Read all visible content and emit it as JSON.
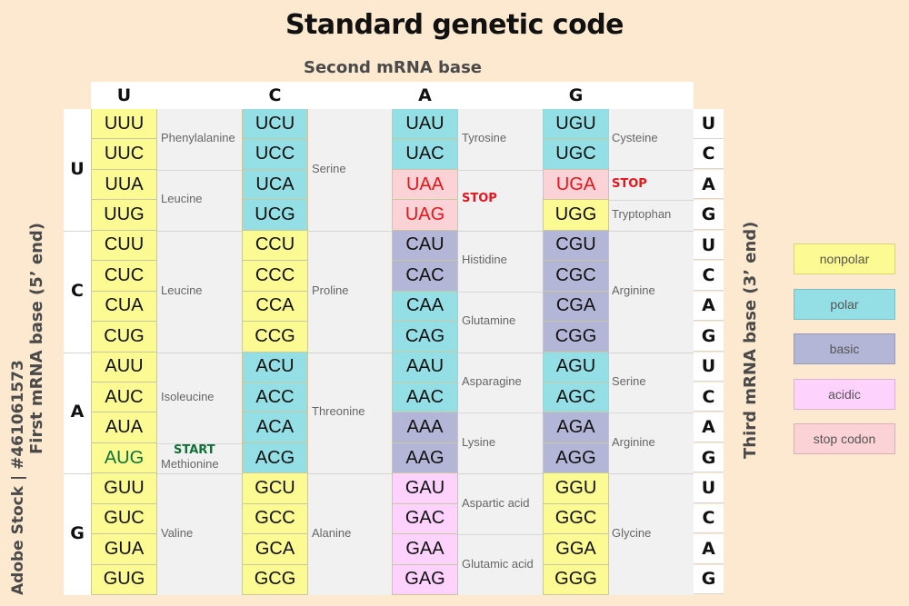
{
  "title": "Standard genetic code",
  "second_base_label": "Second mRNA base",
  "first_base_label": "First mRNA base (5’ end)",
  "third_base_label": "Third mRNA base (3’ end)",
  "watermark": "Adobe Stock | #461061573",
  "bases": [
    "U",
    "C",
    "A",
    "G"
  ],
  "colors": {
    "nonpolar": "#fcfa92",
    "polar": "#93dfe5",
    "basic": "#b4b6d8",
    "acidic": "#fdd3fd",
    "stop": "#fbd2d5",
    "stop_text": "#e8161c",
    "start_text": "#137039"
  },
  "legend": [
    {
      "key": "nonpolar",
      "label": "nonpolar"
    },
    {
      "key": "polar",
      "label": "polar"
    },
    {
      "key": "basic",
      "label": "basic"
    },
    {
      "key": "acidic",
      "label": "acidic"
    },
    {
      "key": "stop",
      "label": "stop codon"
    }
  ],
  "codons": [
    [
      [
        {
          "c": "UUU",
          "t": "nonpolar"
        },
        {
          "c": "UUC",
          "t": "nonpolar"
        },
        {
          "c": "UUA",
          "t": "nonpolar"
        },
        {
          "c": "UUG",
          "t": "nonpolar"
        }
      ],
      [
        {
          "c": "UCU",
          "t": "polar"
        },
        {
          "c": "UCC",
          "t": "polar"
        },
        {
          "c": "UCA",
          "t": "polar"
        },
        {
          "c": "UCG",
          "t": "polar"
        }
      ],
      [
        {
          "c": "UAU",
          "t": "polar"
        },
        {
          "c": "UAC",
          "t": "polar"
        },
        {
          "c": "UAA",
          "t": "stop"
        },
        {
          "c": "UAG",
          "t": "stop"
        }
      ],
      [
        {
          "c": "UGU",
          "t": "polar"
        },
        {
          "c": "UGC",
          "t": "polar"
        },
        {
          "c": "UGA",
          "t": "stop"
        },
        {
          "c": "UGG",
          "t": "nonpolar"
        }
      ]
    ],
    [
      [
        {
          "c": "CUU",
          "t": "nonpolar"
        },
        {
          "c": "CUC",
          "t": "nonpolar"
        },
        {
          "c": "CUA",
          "t": "nonpolar"
        },
        {
          "c": "CUG",
          "t": "nonpolar"
        }
      ],
      [
        {
          "c": "CCU",
          "t": "nonpolar"
        },
        {
          "c": "CCC",
          "t": "nonpolar"
        },
        {
          "c": "CCA",
          "t": "nonpolar"
        },
        {
          "c": "CCG",
          "t": "nonpolar"
        }
      ],
      [
        {
          "c": "CAU",
          "t": "basic"
        },
        {
          "c": "CAC",
          "t": "basic"
        },
        {
          "c": "CAA",
          "t": "polar"
        },
        {
          "c": "CAG",
          "t": "polar"
        }
      ],
      [
        {
          "c": "CGU",
          "t": "basic"
        },
        {
          "c": "CGC",
          "t": "basic"
        },
        {
          "c": "CGA",
          "t": "basic"
        },
        {
          "c": "CGG",
          "t": "basic"
        }
      ]
    ],
    [
      [
        {
          "c": "AUU",
          "t": "nonpolar"
        },
        {
          "c": "AUC",
          "t": "nonpolar"
        },
        {
          "c": "AUA",
          "t": "nonpolar"
        },
        {
          "c": "AUG",
          "t": "nonpolar",
          "start": true
        }
      ],
      [
        {
          "c": "ACU",
          "t": "polar"
        },
        {
          "c": "ACC",
          "t": "polar"
        },
        {
          "c": "ACA",
          "t": "polar"
        },
        {
          "c": "ACG",
          "t": "polar"
        }
      ],
      [
        {
          "c": "AAU",
          "t": "polar"
        },
        {
          "c": "AAC",
          "t": "polar"
        },
        {
          "c": "AAA",
          "t": "basic"
        },
        {
          "c": "AAG",
          "t": "basic"
        }
      ],
      [
        {
          "c": "AGU",
          "t": "polar"
        },
        {
          "c": "AGC",
          "t": "polar"
        },
        {
          "c": "AGA",
          "t": "basic"
        },
        {
          "c": "AGG",
          "t": "basic"
        }
      ]
    ],
    [
      [
        {
          "c": "GUU",
          "t": "nonpolar"
        },
        {
          "c": "GUC",
          "t": "nonpolar"
        },
        {
          "c": "GUA",
          "t": "nonpolar"
        },
        {
          "c": "GUG",
          "t": "nonpolar"
        }
      ],
      [
        {
          "c": "GCU",
          "t": "nonpolar"
        },
        {
          "c": "GCC",
          "t": "nonpolar"
        },
        {
          "c": "GCA",
          "t": "nonpolar"
        },
        {
          "c": "GCG",
          "t": "nonpolar"
        }
      ],
      [
        {
          "c": "GAU",
          "t": "acidic"
        },
        {
          "c": "GAC",
          "t": "acidic"
        },
        {
          "c": "GAA",
          "t": "acidic"
        },
        {
          "c": "GAG",
          "t": "acidic"
        }
      ],
      [
        {
          "c": "GGU",
          "t": "nonpolar"
        },
        {
          "c": "GGC",
          "t": "nonpolar"
        },
        {
          "c": "GGA",
          "t": "nonpolar"
        },
        {
          "c": "GGG",
          "t": "nonpolar"
        }
      ]
    ]
  ],
  "amino_acids": [
    [
      [
        {
          "name": "Phenylalanine",
          "rows": [
            0,
            1
          ]
        },
        {
          "name": "Leucine",
          "rows": [
            2,
            3
          ]
        }
      ],
      [
        {
          "name": "Serine",
          "rows": [
            0,
            3
          ]
        }
      ],
      [
        {
          "name": "Tyrosine",
          "rows": [
            0,
            1
          ]
        },
        {
          "name": "STOP",
          "rows": [
            2,
            3
          ],
          "stop": true
        }
      ],
      [
        {
          "name": "Cysteine",
          "rows": [
            0,
            1
          ]
        },
        {
          "name": "STOP",
          "rows": [
            2,
            2
          ],
          "stop": true
        },
        {
          "name": "Tryptophan",
          "rows": [
            3,
            3
          ]
        }
      ]
    ],
    [
      [
        {
          "name": "Leucine",
          "rows": [
            0,
            3
          ]
        }
      ],
      [
        {
          "name": "Proline",
          "rows": [
            0,
            3
          ]
        }
      ],
      [
        {
          "name": "Histidine",
          "rows": [
            0,
            1
          ]
        },
        {
          "name": "Glutamine",
          "rows": [
            2,
            3
          ]
        }
      ],
      [
        {
          "name": "Arginine",
          "rows": [
            0,
            3
          ]
        }
      ]
    ],
    [
      [
        {
          "name": "Isoleucine",
          "rows": [
            0,
            2
          ]
        },
        {
          "name": "Methionine",
          "rows": [
            3,
            3
          ],
          "start_label": "START"
        }
      ],
      [
        {
          "name": "Threonine",
          "rows": [
            0,
            3
          ]
        }
      ],
      [
        {
          "name": "Asparagine",
          "rows": [
            0,
            1
          ]
        },
        {
          "name": "Lysine",
          "rows": [
            2,
            3
          ]
        }
      ],
      [
        {
          "name": "Serine",
          "rows": [
            0,
            1
          ]
        },
        {
          "name": "Arginine",
          "rows": [
            2,
            3
          ]
        }
      ]
    ],
    [
      [
        {
          "name": "Valine",
          "rows": [
            0,
            3
          ]
        }
      ],
      [
        {
          "name": "Alanine",
          "rows": [
            0,
            3
          ]
        }
      ],
      [
        {
          "name": "Aspartic acid",
          "rows": [
            0,
            1
          ]
        },
        {
          "name": "Glutamic acid",
          "rows": [
            2,
            3
          ]
        }
      ],
      [
        {
          "name": "Glycine",
          "rows": [
            0,
            3
          ]
        }
      ]
    ]
  ]
}
